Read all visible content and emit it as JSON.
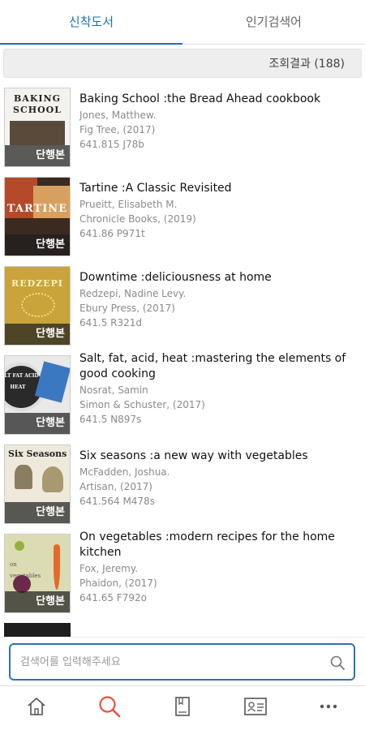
{
  "tabs": [
    {
      "label": "신착도서",
      "active": true
    },
    {
      "label": "인기검색어",
      "active": false
    }
  ],
  "result_summary": "조회결과 (188)",
  "books": [
    {
      "title": "Baking School :the Bread Ahead cookbook",
      "author": "Jones, Matthew.",
      "publisher": "Fig Tree,  (2017)",
      "call_number": "641.815 J78b",
      "badge": "단행본",
      "cover_text": "BAKING SCHOOL"
    },
    {
      "title": "Tartine :A Classic Revisited",
      "author": "Prueitt, Elisabeth M.",
      "publisher": "Chronicle Books,  (2019)",
      "call_number": "641.86 P971t",
      "badge": "단행본",
      "cover_text": "TARTINE"
    },
    {
      "title": "Downtime :deliciousness at home",
      "author": "Redzepi, Nadine Levy.",
      "publisher": "Ebury Press,  (2017)",
      "call_number": "641.5 R321d",
      "badge": "단행본",
      "cover_text": "REDZEPI"
    },
    {
      "title": "Salt, fat, acid, heat    :mastering the elements of good cooking",
      "author": "Nosrat, Samin",
      "publisher": "Simon & Schuster,  (2017)",
      "call_number": "641.5 N897s",
      "badge": "단행본",
      "cover_text": "SALT FAT ACID HEAT"
    },
    {
      "title": "Six seasons :a new way with vegetables",
      "author": "McFadden, Joshua.",
      "publisher": "Artisan,  (2017)",
      "call_number": "641.564 M478s",
      "badge": "단행본",
      "cover_text": "Six Seasons"
    },
    {
      "title": "On vegetables :modern recipes for the home kitchen",
      "author": "Fox, Jeremy.",
      "publisher": "Phaidon,  (2017)",
      "call_number": "641.65 F792o",
      "badge": "단행본",
      "cover_text": "on vegetables"
    }
  ],
  "search": {
    "placeholder": "검색어를 입력해주세요"
  },
  "bottom_nav": [
    {
      "icon": "home-icon",
      "active": false
    },
    {
      "icon": "search-icon",
      "active": true
    },
    {
      "icon": "book-icon",
      "active": false
    },
    {
      "icon": "id-card-icon",
      "active": false
    },
    {
      "icon": "more-icon",
      "active": false
    }
  ],
  "colors": {
    "accent": "#1c72b6",
    "search_active": "#e5533d",
    "badge_bg": "#333333"
  }
}
